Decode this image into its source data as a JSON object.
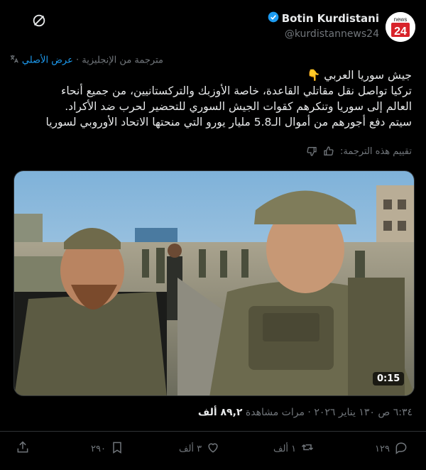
{
  "author": {
    "name": "Botin Kurdistani",
    "handle": "@kurdistannews24",
    "avatar_text": "news",
    "avatar_number": "24"
  },
  "translation": {
    "show_original": "عرض الأصلي",
    "translated_from": "مترجمة من الإنجليزية"
  },
  "post": {
    "line1": "جيش سوريا العربي 👇",
    "line2": "تركيا تواصل نقل مقاتلي القاعدة، خاصة الأوزبك والتركستانيين، من جميع أنحاء",
    "line3": "العالم إلى سوريا وتنكرهم كقوات الجيش السوري للتحضير لحرب ضد الأكراد.",
    "line4": "سيتم دفع أجورهم من أموال الـ5.8 مليار يورو التي منحتها الاتحاد الأوروبي لسوريا"
  },
  "rate": {
    "label": "تقييم هذه الترجمة:"
  },
  "media": {
    "duration": "0:15"
  },
  "meta": {
    "time_date": "٦:٣٤ ص ١٣٠ يناير ٢٠٢٦ · مرات مشاهدة",
    "views": "٨٩,٢ ألف"
  },
  "actions": {
    "replies": "١٢٩",
    "reposts": "١ ألف",
    "likes": "٣ ألف",
    "bookmarks": "٢٩٠"
  },
  "colors": {
    "accent": "#1d9bf0",
    "muted": "#71767b",
    "text": "#e7e9ea",
    "avatar_red": "#d8232a"
  }
}
